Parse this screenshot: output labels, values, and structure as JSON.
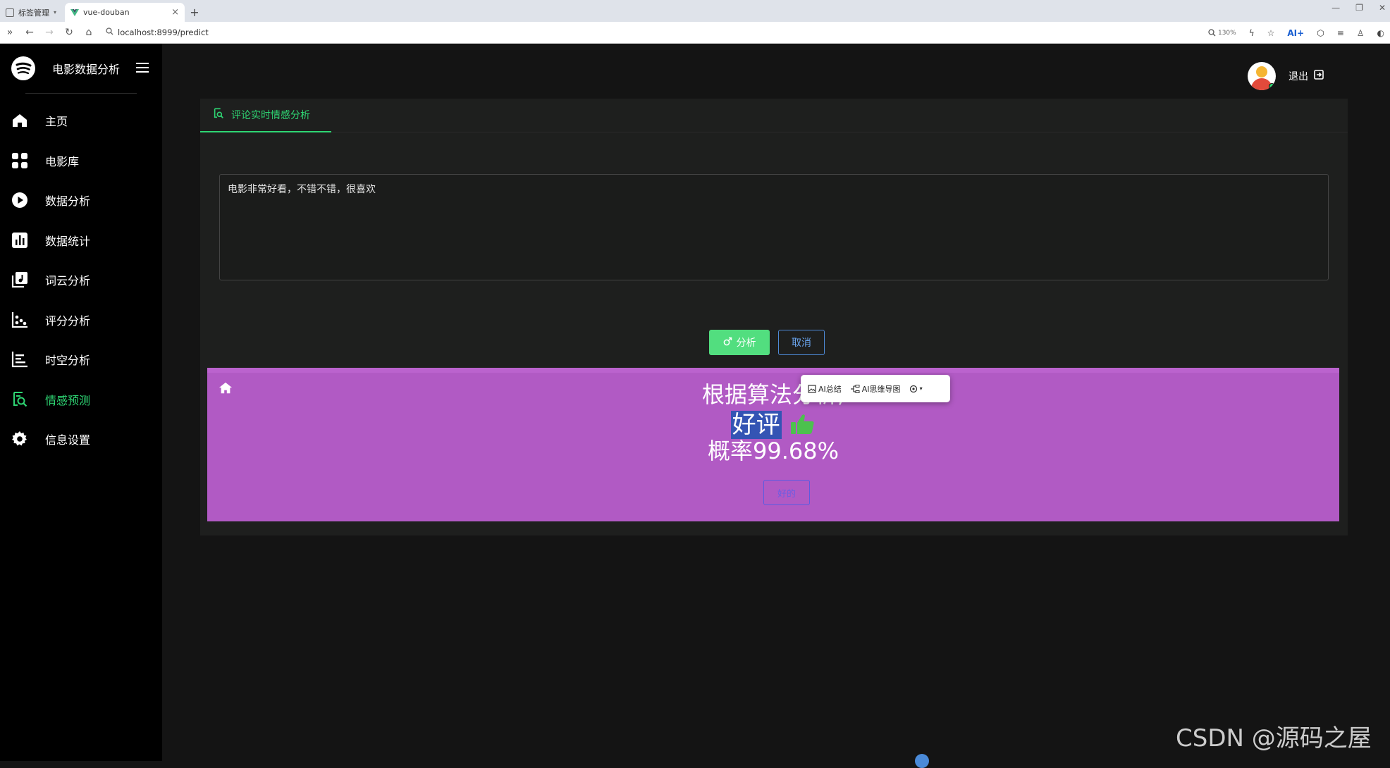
{
  "browser": {
    "tabs": [
      {
        "label": "标签管理",
        "active": false
      },
      {
        "label": "vue-douban",
        "active": true
      }
    ],
    "url": "localhost:8999/predict",
    "zoom": "130%",
    "ai_label": "AI+"
  },
  "sidebar": {
    "app_name": "电影数据分析",
    "items": [
      {
        "label": "主页",
        "icon": "home-icon",
        "active": false
      },
      {
        "label": "电影库",
        "icon": "grid-icon",
        "active": false
      },
      {
        "label": "数据分析",
        "icon": "play-icon",
        "active": false
      },
      {
        "label": "数据统计",
        "icon": "bar-chart-icon",
        "active": false
      },
      {
        "label": "词云分析",
        "icon": "music-library-icon",
        "active": false
      },
      {
        "label": "评分分析",
        "icon": "scatter-icon",
        "active": false
      },
      {
        "label": "时空分析",
        "icon": "timeline-icon",
        "active": false
      },
      {
        "label": "情感预测",
        "icon": "search-doc-icon",
        "active": true
      },
      {
        "label": "信息设置",
        "icon": "gear-icon",
        "active": false
      }
    ]
  },
  "header": {
    "logout_label": "退出"
  },
  "main": {
    "tab_label": "评论实时情感分析",
    "comment_value": "电影非常好看，不错不错，很喜欢",
    "analyze_label": "分析",
    "cancel_label": "取消",
    "result": {
      "title": "根据算法分析,",
      "verdict": "好评",
      "probability": "概率99.68%",
      "ok_label": "好的"
    }
  },
  "ai_popup": {
    "summary_label": "AI总结",
    "mindmap_label": "AI思维导图"
  },
  "watermark": "CSDN @源码之屋",
  "colors": {
    "accent": "#2ed573",
    "result_bg": "#b15ac4",
    "sidebar_bg": "#000000",
    "main_bg": "#141414"
  }
}
